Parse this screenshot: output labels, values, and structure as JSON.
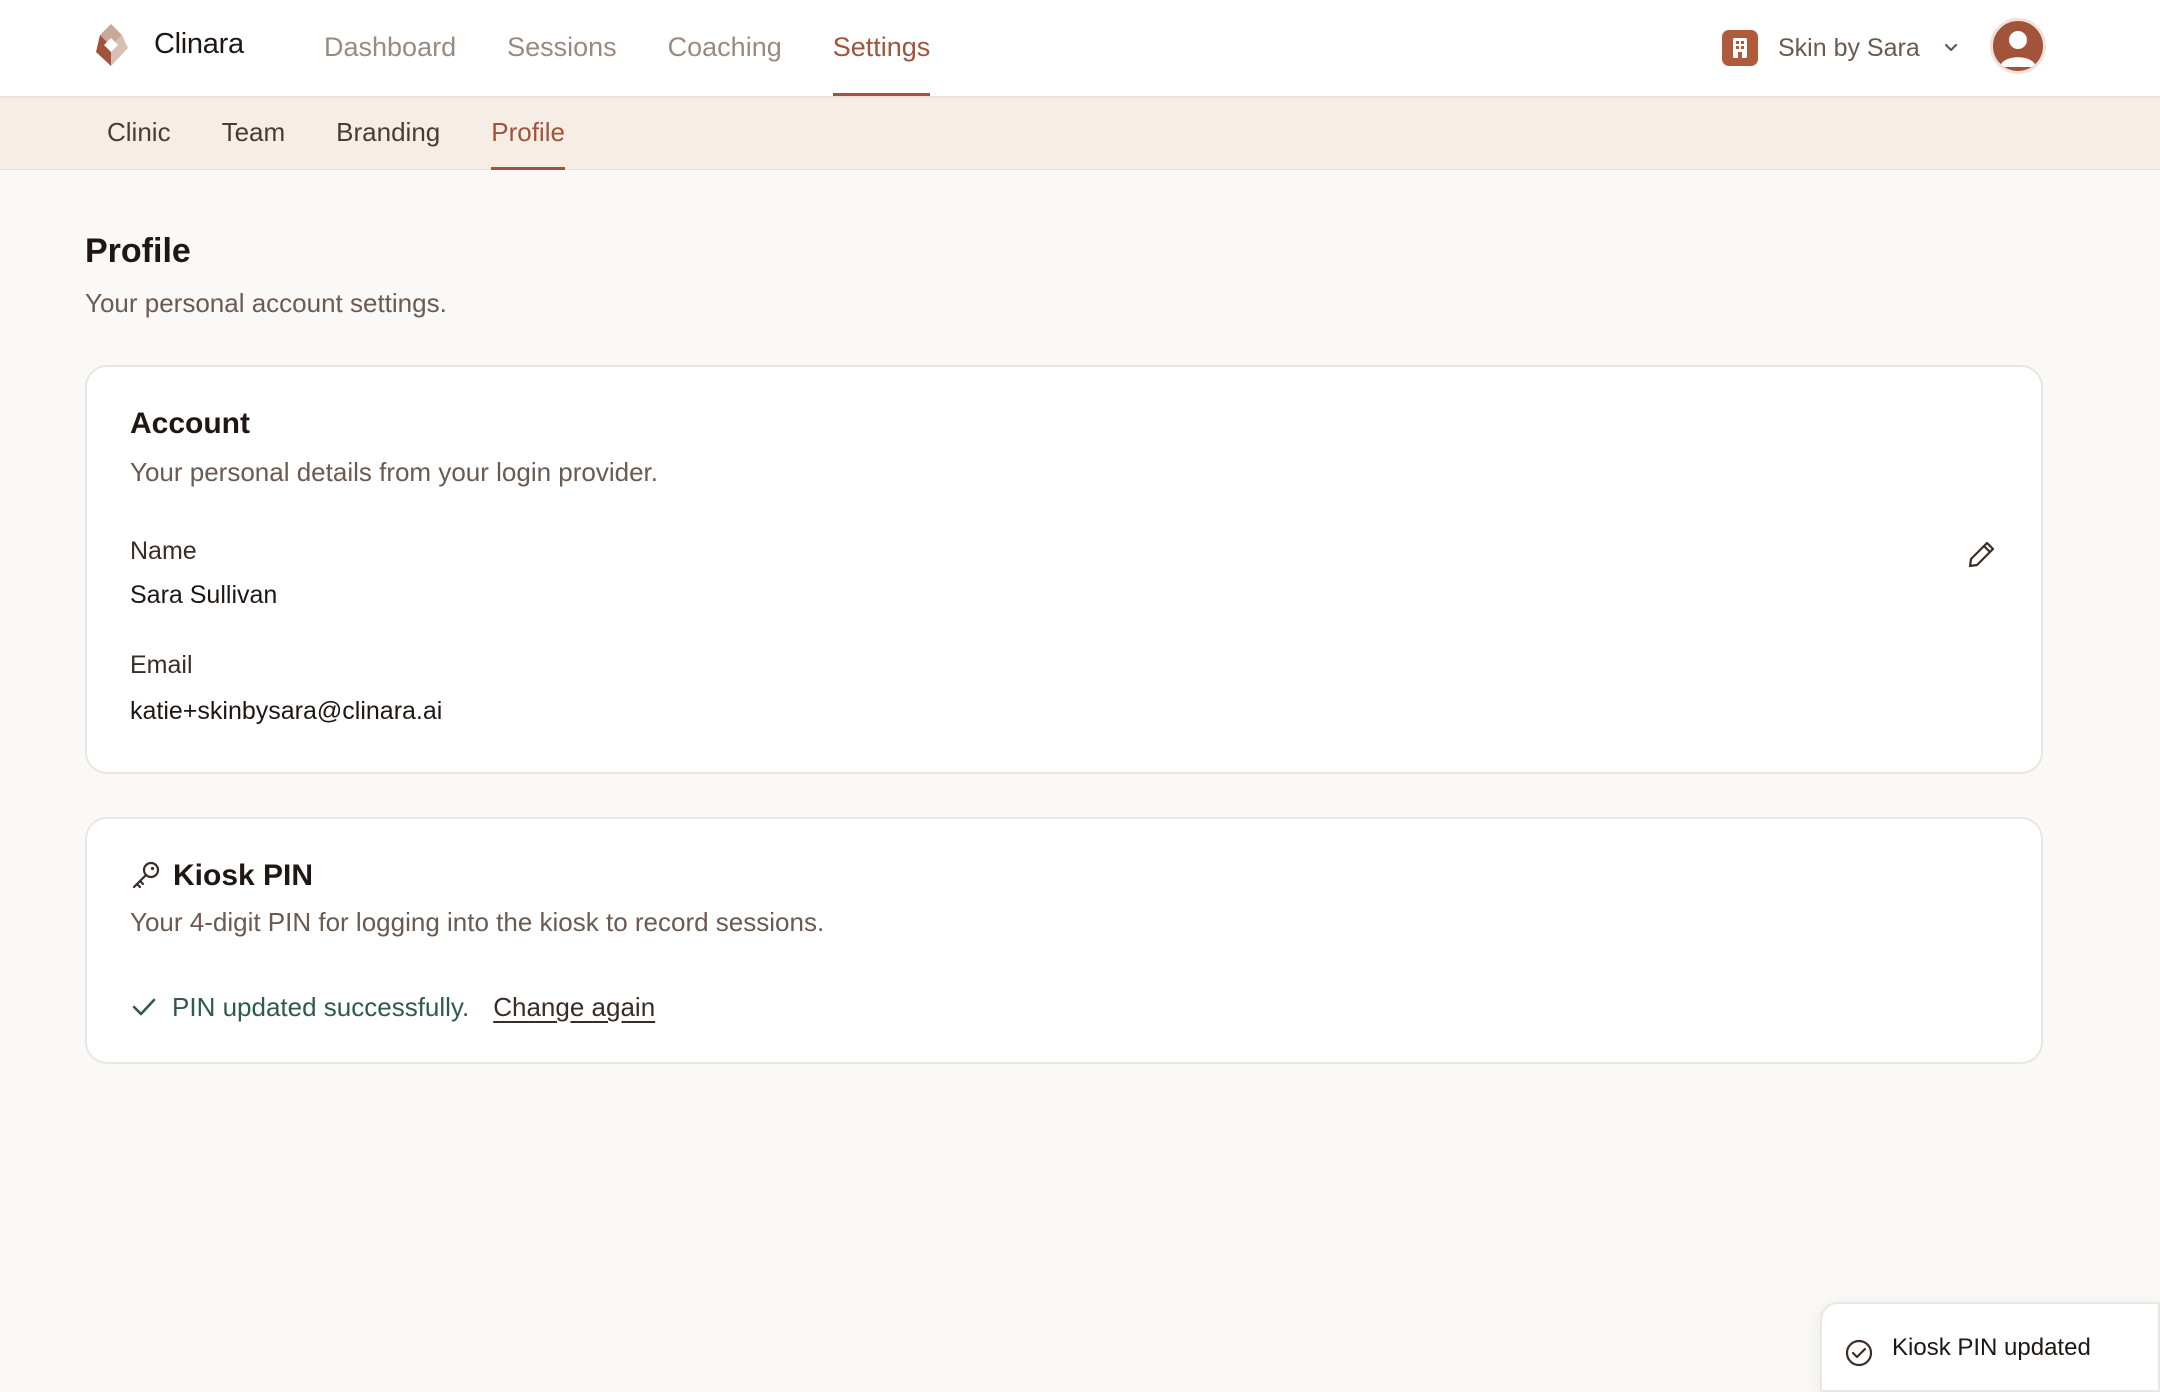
{
  "app": {
    "brand": "Clinara"
  },
  "nav": {
    "items": [
      {
        "label": "Dashboard"
      },
      {
        "label": "Sessions"
      },
      {
        "label": "Coaching"
      },
      {
        "label": "Settings",
        "active": true
      }
    ]
  },
  "clinic_switcher": {
    "name": "Skin by Sara",
    "icon": "building-icon"
  },
  "settings_tabs": {
    "items": [
      {
        "label": "Clinic"
      },
      {
        "label": "Team"
      },
      {
        "label": "Branding"
      },
      {
        "label": "Profile",
        "active": true
      }
    ]
  },
  "page": {
    "title": "Profile",
    "subtitle": "Your personal account settings."
  },
  "account": {
    "title": "Account",
    "subtitle": "Your personal details from your login provider.",
    "name_label": "Name",
    "name_value": "Sara Sullivan",
    "email_label": "Email",
    "email_value": "katie+skinbysara@clinara.ai"
  },
  "kiosk": {
    "title": "Kiosk PIN",
    "subtitle": "Your 4-digit PIN for logging into the kiosk to record sessions.",
    "status": "PIN updated successfully.",
    "change_link": "Change again"
  },
  "toast": {
    "text": "Kiosk PIN updated"
  },
  "colors": {
    "accent": "#a1543a",
    "success": "#2f5b4c",
    "background": "#faf9f7",
    "subnav_bg": "#f6ede7"
  }
}
